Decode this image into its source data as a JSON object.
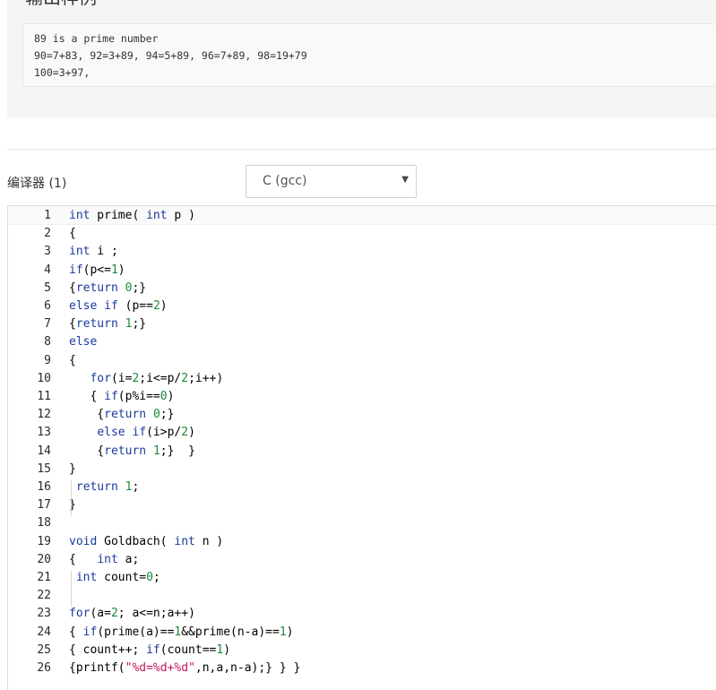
{
  "sample_output": {
    "heading": "输出样例",
    "lines": [
      "89 is a prime number",
      "90=7+83, 92=3+89, 94=5+89, 96=7+89, 98=19+79",
      "100=3+97,"
    ]
  },
  "compiler": {
    "label": "编译器 (1)",
    "selected": "C (gcc)",
    "arrow": "▼"
  },
  "editor": {
    "colors": {
      "keyword": "#1d3a9e",
      "number": "#1a8a3a",
      "string": "#c2185b"
    },
    "lines": [
      "int prime( int p )",
      "{",
      "int i ;",
      "if(p<=1)",
      "{return 0;}",
      "else if (p==2)",
      "{return 1;}",
      "else",
      "{",
      "   for(i=2;i<=p/2;i++)",
      "   { if(p%i==0)",
      "    {return 0;}",
      "    else if(i>p/2)",
      "    {return 1;}  }",
      "}",
      " return 1;",
      "}",
      "",
      "void Goldbach( int n )",
      "{   int a;",
      " int count=0;",
      "",
      "for(a=2; a<=n;a++)",
      "{ if(prime(a)==1&&prime(n-a)==1)",
      "{ count++; if(count==1)",
      "{printf(\"%d=%d+%d\",n,a,n-a);} } }"
    ]
  }
}
